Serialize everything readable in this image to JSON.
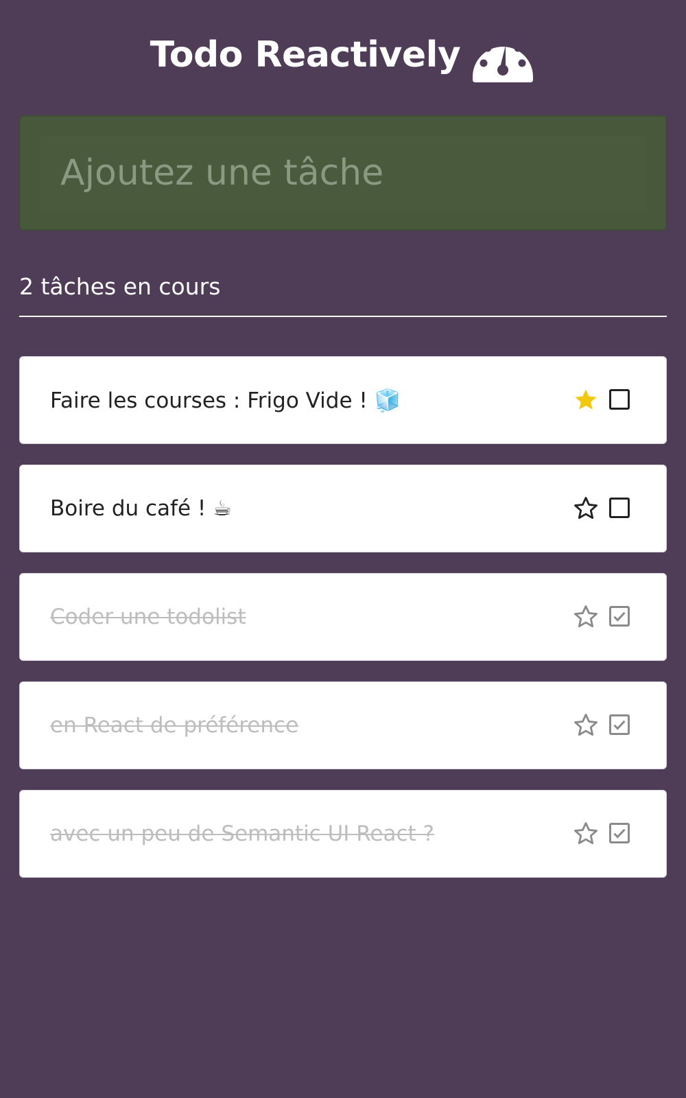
{
  "app": {
    "title": "Todo Reactively",
    "title_icon": "dashboard-gauge-icon"
  },
  "input": {
    "placeholder": "Ajoutez une tâche",
    "value": ""
  },
  "status": {
    "counter_text": "2 tâches en cours"
  },
  "colors": {
    "background": "#4f3d58",
    "input_background": "#4a5a3d",
    "star_active": "#f2c80f",
    "done_text": "#bdbdbd"
  },
  "tasks": [
    {
      "label": "Faire les courses : Frigo Vide ! 🧊",
      "favorite": true,
      "done": false
    },
    {
      "label": "Boire du café ! ☕",
      "favorite": false,
      "done": false
    },
    {
      "label": "Coder une todolist",
      "favorite": false,
      "done": true
    },
    {
      "label": "en React de préférence",
      "favorite": false,
      "done": true
    },
    {
      "label": "avec un peu de Semantic UI React ?",
      "favorite": false,
      "done": true
    }
  ]
}
